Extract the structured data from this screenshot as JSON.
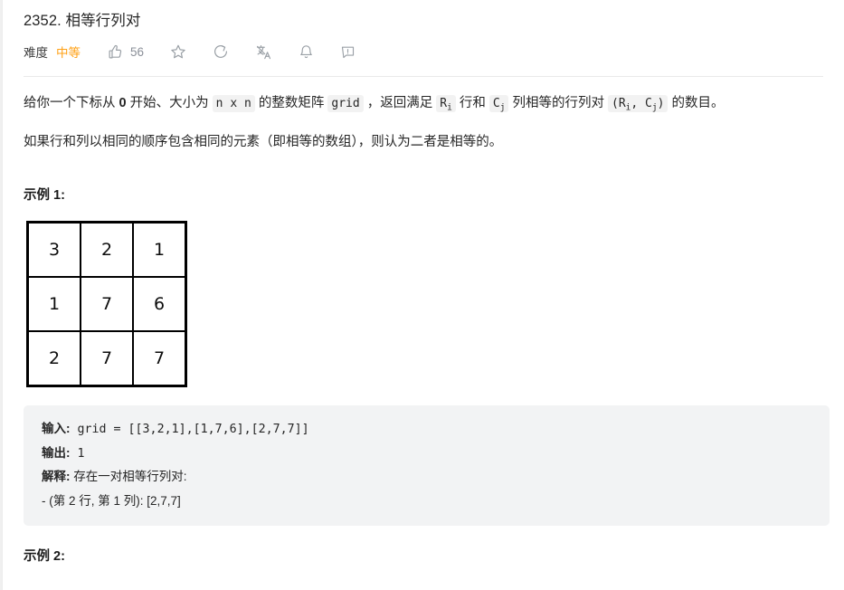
{
  "colors": {
    "accent_medium": "#ffa116",
    "code_bg": "#f2f3f4",
    "inline_code_bg": "#f2f2f2",
    "text": "#262626",
    "divider": "#eaeaea"
  },
  "header": {
    "title": "2352. 相等行列对",
    "difficulty_label": "难度",
    "difficulty_value": "中等",
    "like_count": "56",
    "icons": [
      {
        "name": "thumbs-up-icon"
      },
      {
        "name": "star-icon"
      },
      {
        "name": "share-icon"
      },
      {
        "name": "translate-icon"
      },
      {
        "name": "bell-icon"
      },
      {
        "name": "feedback-icon"
      }
    ]
  },
  "description": {
    "p1": {
      "t1": "给你一个下标从 ",
      "zero": "0",
      "t2": " 开始、大小为 ",
      "code_nxn": "n x n",
      "t3": " 的整数矩阵 ",
      "code_grid": "grid",
      "t4": " ，返回满足 ",
      "code_ri_base": "R",
      "code_ri_sub": "i",
      "t5": " 行和 ",
      "code_cj_base": "C",
      "code_cj_sub": "j",
      "t6": " 列相等的行列对 ",
      "code_pair_open": "(R",
      "code_pair_sub1": "i",
      "code_pair_mid": ", C",
      "code_pair_sub2": "j",
      "code_pair_close": ")",
      "t7": " 的数目。"
    },
    "p2": "如果行和列以相同的顺序包含相同的元素（即相等的数组），则认为二者是相等的。"
  },
  "example1": {
    "heading": "示例 1:",
    "grid": [
      [
        "3",
        "2",
        "1"
      ],
      [
        "1",
        "7",
        "6"
      ],
      [
        "2",
        "7",
        "7"
      ]
    ],
    "block": {
      "input_label": "输入:",
      "input_value": " grid = [[3,2,1],[1,7,6],[2,7,7]]",
      "output_label": "输出:",
      "output_value": " 1",
      "explain_label": "解释:",
      "explain_value": " 存在一对相等行列对:",
      "explain_line2": "- (第 2 行, 第 1 列): [2,7,7]"
    }
  },
  "example2": {
    "heading": "示例 2:"
  }
}
